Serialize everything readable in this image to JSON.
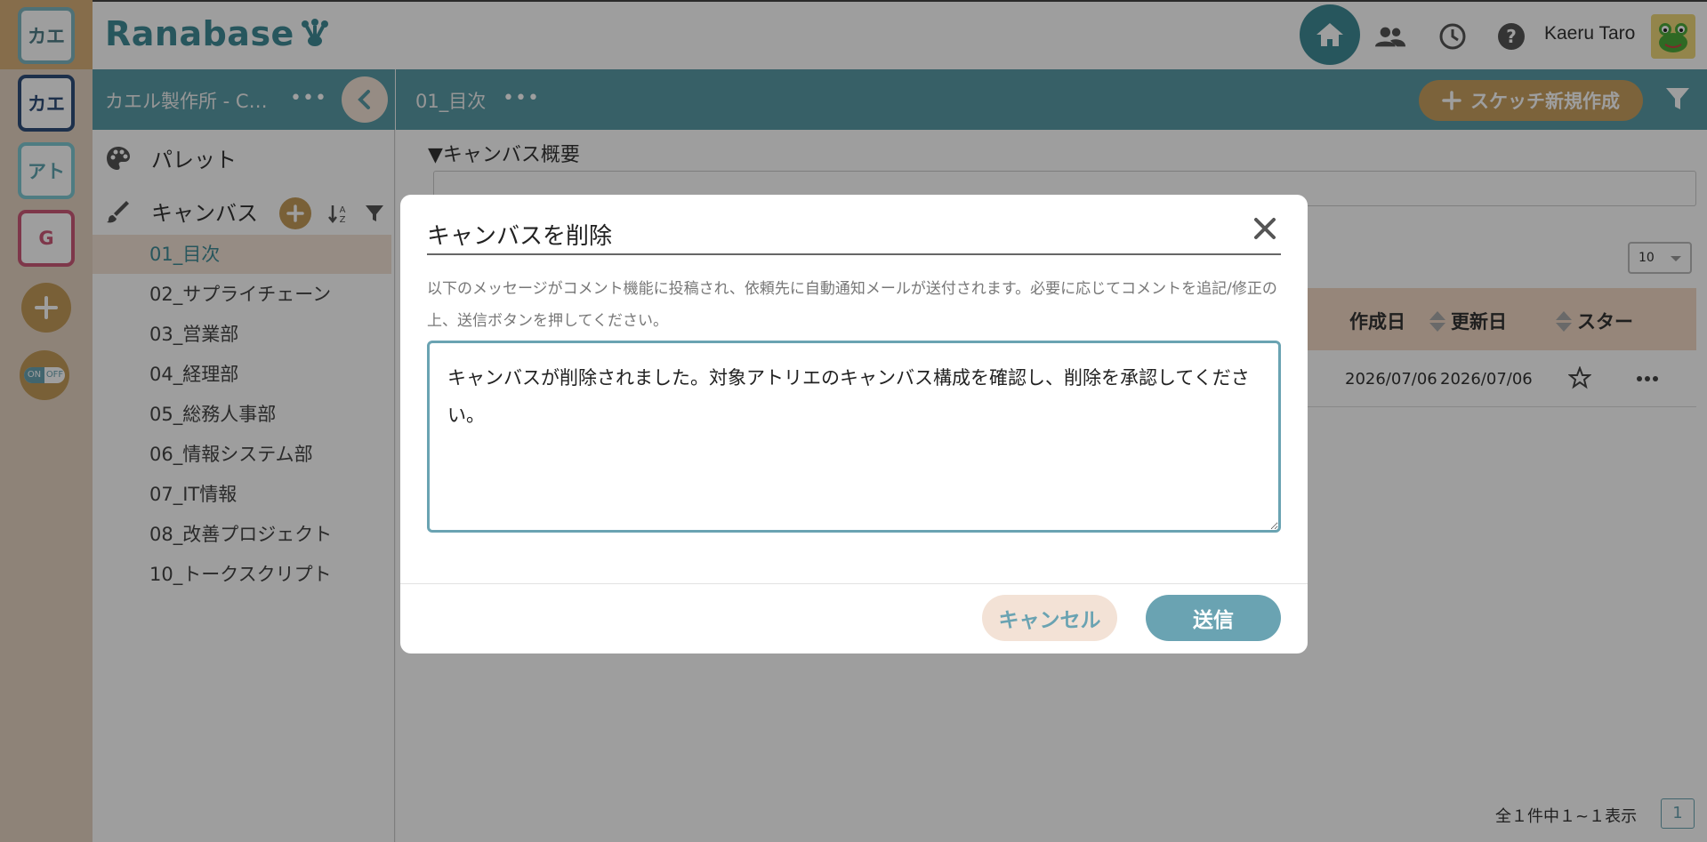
{
  "rail": {
    "workspaces": [
      "カエ",
      "カエ",
      "アト",
      "G"
    ],
    "toggle_on": "ON",
    "toggle_off": "OFF"
  },
  "header": {
    "logo": "Ranabase",
    "user_name": "Kaeru Taro"
  },
  "sidebar": {
    "title": "カエル製作所 - C…",
    "more": "•••",
    "palette_label": "パレット",
    "canvas_label": "キャンバス",
    "items": [
      {
        "label": "01_目次",
        "active": true
      },
      {
        "label": "02_サプライチェーン"
      },
      {
        "label": "03_営業部"
      },
      {
        "label": "04_経理部"
      },
      {
        "label": "05_総務人事部"
      },
      {
        "label": "06_情報システム部"
      },
      {
        "label": "07_IT情報"
      },
      {
        "label": "08_改善プロジェクト"
      },
      {
        "label": "10_トークスクリプト"
      }
    ]
  },
  "main": {
    "title": "01_目次",
    "more": "•••",
    "new_sketch_label": "スケッチ新規作成",
    "summary_toggle": "▼キャンバス概要",
    "per_page": "10",
    "columns": {
      "created": "作成日",
      "updated": "更新日",
      "star": "スター"
    },
    "rows": [
      {
        "created": "2026/07/06",
        "updated": "2026/07/06"
      }
    ],
    "pager_info": "全１件中１~１表示",
    "page_number": "1"
  },
  "modal": {
    "title": "キャンバスを削除",
    "description": "以下のメッセージがコメント機能に投稿され、依頼先に自動通知メールが送付されます。必要に応じてコメントを追記/修正の上、送信ボタンを押してください。",
    "message": "キャンバスが削除されました。対象アトリエのキャンバス構成を確認し、削除を承認してください。",
    "cancel_label": "キャンセル",
    "send_label": "送信"
  },
  "colors": {
    "teal": "#5a9ca7",
    "accent_gold": "#c49c5a",
    "highlight_beige": "#f3e2d6"
  }
}
